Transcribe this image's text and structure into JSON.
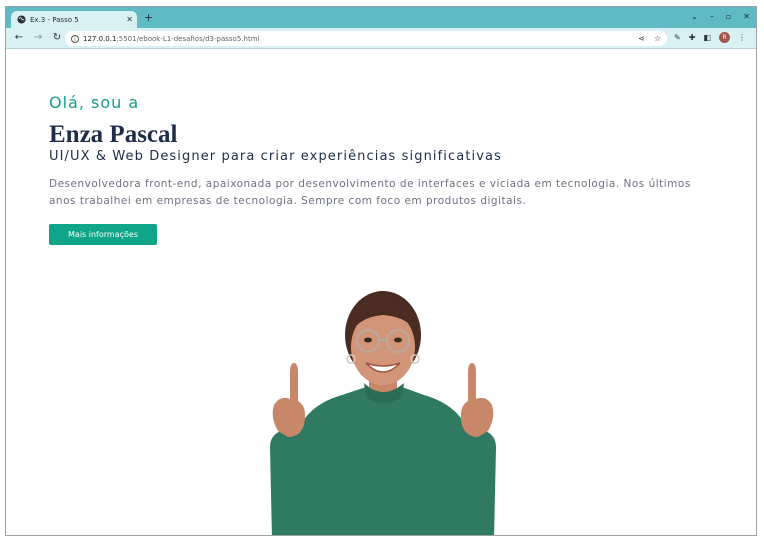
{
  "browser": {
    "tab_title": "Ex.3 - Passo 5",
    "new_tab": "+",
    "url_host": "127.0.0.1",
    "url_rest": ":5501/ebook-L1-desafios/d3-passo5.html",
    "profile_initial": "R"
  },
  "hero": {
    "greeting": "Olá, sou a",
    "name": "Enza Pascal",
    "role": "UI/UX & Web Designer para criar experiências significativas",
    "description": "Desenvolvedora front-end, apaixonada por desenvolvimento de interfaces e viciada em tecnologia. Nos últimos anos trabalhei em empresas de tecnologia. Sempre com foco em produtos digitais.",
    "button_label": "Mais informações"
  },
  "colors": {
    "tab_strip": "#5fbac4",
    "accent": "#10a58a",
    "heading": "#1f2d48"
  }
}
